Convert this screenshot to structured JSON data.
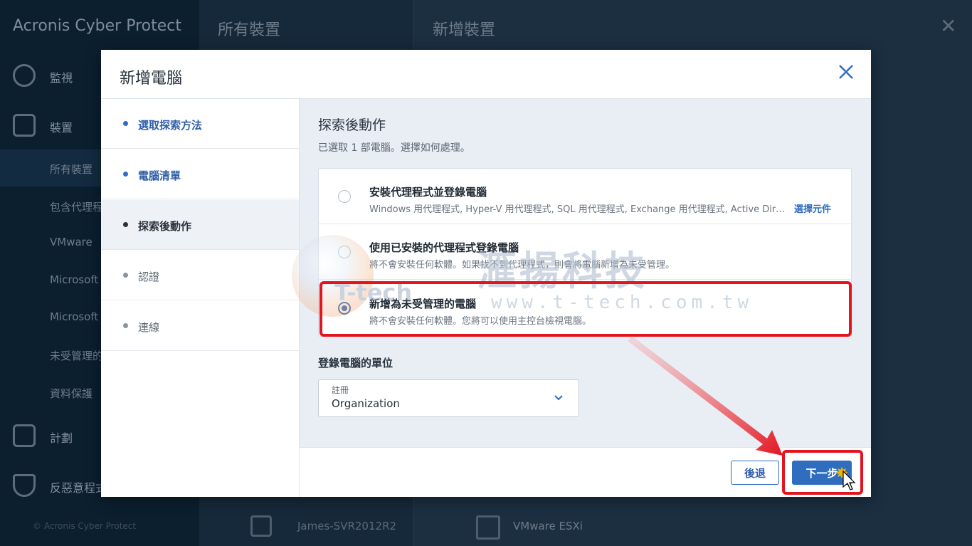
{
  "background": {
    "logo": "Acronis Cyber Protect",
    "nav": [
      {
        "label": "監視",
        "icon": "dashboard-icon"
      },
      {
        "label": "裝置",
        "icon": "monitor-icon"
      }
    ],
    "sub_nav": [
      "所有裝置",
      "包含代理程式",
      "VMware",
      "Microsoft",
      "Microsoft",
      "未受管理的",
      "資料保護"
    ],
    "nav_bottom": [
      {
        "label": "計劃",
        "icon": "plans-icon"
      },
      {
        "label": "反惡意程式",
        "icon": "shield-icon"
      }
    ],
    "footer": "© Acronis Cyber Protect",
    "middle_title": "所有裝置",
    "middle_row": "James-SVR2012R2",
    "right_title": "新增裝置",
    "right_row": "VMware ESXi"
  },
  "dialog": {
    "title": "新增電腦",
    "steps": [
      {
        "label": "選取探索方法",
        "state": "done"
      },
      {
        "label": "電腦清單",
        "state": "done"
      },
      {
        "label": "探索後動作",
        "state": "current"
      },
      {
        "label": "認證",
        "state": "todo"
      },
      {
        "label": "連線",
        "state": "todo"
      }
    ],
    "section_title": "探索後動作",
    "section_subtitle": "已選取 1 部電腦。選擇如何處理。",
    "options": [
      {
        "title": "安裝代理程式並登錄電腦",
        "description": "Windows 用代理程式, Hyper-V 用代理程式, SQL 用代理程式, Exchange 用代理程式, Active Director…",
        "link": "選擇元件",
        "checked": false
      },
      {
        "title": "使用已安裝的代理程式登錄電腦",
        "description": "將不會安裝任何軟體。如果找不到代理程式，則會將電腦新增為未受管理。",
        "checked": false
      },
      {
        "title": "新增為未受管理的電腦",
        "description": "將不會安裝任何軟體。您將可以使用主控台檢視電腦。",
        "checked": true
      }
    ],
    "unit_label": "登錄電腦的單位",
    "unit_select": {
      "caption": "註冊",
      "value": "Organization"
    },
    "back_label": "後退",
    "next_label": "下一步"
  },
  "watermark": {
    "brand": "T-tech",
    "chinese": "滙揚科技",
    "url": "www.t-tech.com.tw"
  },
  "colors": {
    "accent": "#2f6dbf",
    "highlight": "#e3141e"
  }
}
